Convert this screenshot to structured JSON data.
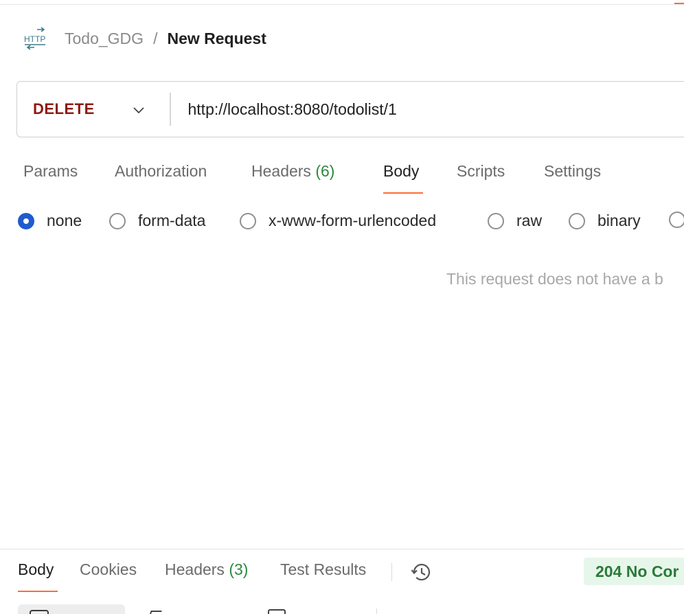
{
  "breadcrumb": {
    "icon": "http-request-icon",
    "collection": "Todo_GDG",
    "separator": "/",
    "request": "New Request"
  },
  "request": {
    "method": "DELETE",
    "url": "http://localhost:8080/todolist/1"
  },
  "request_tabs": [
    {
      "label": "Params"
    },
    {
      "label": "Authorization"
    },
    {
      "label": "Headers",
      "count": "(6)"
    },
    {
      "label": "Body",
      "active": true
    },
    {
      "label": "Scripts"
    },
    {
      "label": "Settings"
    }
  ],
  "body_types": [
    {
      "label": "none",
      "checked": true
    },
    {
      "label": "form-data"
    },
    {
      "label": "x-www-form-urlencoded"
    },
    {
      "label": "raw"
    },
    {
      "label": "binary"
    }
  ],
  "body_empty_message": "This request does not have a b",
  "response": {
    "tabs": [
      {
        "label": "Body",
        "active": true
      },
      {
        "label": "Cookies"
      },
      {
        "label": "Headers",
        "count": "(3)"
      },
      {
        "label": "Test Results"
      }
    ],
    "history_icon": "history-icon",
    "status": "204 No Cor"
  },
  "colors": {
    "accent": "#ff6c37",
    "method_delete": "#8e1a10",
    "radio_selected": "#1f5bd0",
    "count_green": "#2b8a3e",
    "status_bg": "#e7f6ea",
    "status_text": "#2a7a39"
  }
}
